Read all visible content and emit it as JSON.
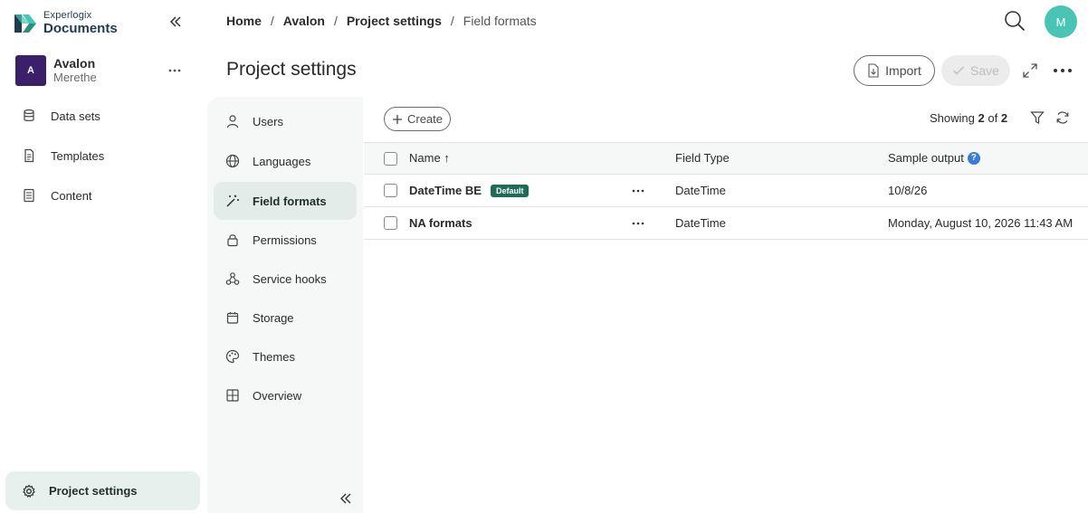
{
  "app": {
    "logo_small": "Experlogix",
    "logo_big": "Documents"
  },
  "project": {
    "avatar_letter": "A",
    "name": "Avalon",
    "user": "Merethe"
  },
  "sidebar": {
    "items": [
      {
        "label": "Data sets",
        "icon": "database-icon"
      },
      {
        "label": "Templates",
        "icon": "document-icon"
      },
      {
        "label": "Content",
        "icon": "content-icon"
      }
    ],
    "settings_label": "Project settings"
  },
  "breadcrumb": {
    "items": [
      "Home",
      "Avalon",
      "Project settings"
    ],
    "current": "Field formats",
    "separator": "/"
  },
  "user": {
    "avatar_letter": "M",
    "avatar_color": "#49c5b6"
  },
  "header": {
    "title": "Project settings",
    "import_label": "Import",
    "save_label": "Save"
  },
  "subnav": {
    "items": [
      {
        "label": "Users",
        "icon": "user-icon"
      },
      {
        "label": "Languages",
        "icon": "globe-icon"
      },
      {
        "label": "Field formats",
        "icon": "magic-wand-icon",
        "active": true
      },
      {
        "label": "Permissions",
        "icon": "lock-icon"
      },
      {
        "label": "Service hooks",
        "icon": "webhook-icon"
      },
      {
        "label": "Storage",
        "icon": "storage-icon"
      },
      {
        "label": "Themes",
        "icon": "palette-icon"
      },
      {
        "label": "Overview",
        "icon": "grid-icon"
      }
    ]
  },
  "toolbar": {
    "create_label": "Create",
    "showing_prefix": "Showing",
    "showing_count": "2",
    "showing_of": "of",
    "showing_total": "2"
  },
  "table": {
    "columns": {
      "name": "Name",
      "sort_indicator": "↑",
      "field_type": "Field Type",
      "sample_output": "Sample output",
      "help": "?"
    },
    "rows": [
      {
        "name": "DateTime BE",
        "badge": "Default",
        "field_type": "DateTime",
        "sample": "10/8/26"
      },
      {
        "name": "NA formats",
        "badge": "",
        "field_type": "DateTime",
        "sample": "Monday, August 10, 2026 11:43 AM"
      }
    ]
  },
  "colors": {
    "accent": "#1e6b58",
    "project_avatar": "#3b1f6b",
    "active_bg": "#e3ece9",
    "help": "#3a7bd5"
  }
}
